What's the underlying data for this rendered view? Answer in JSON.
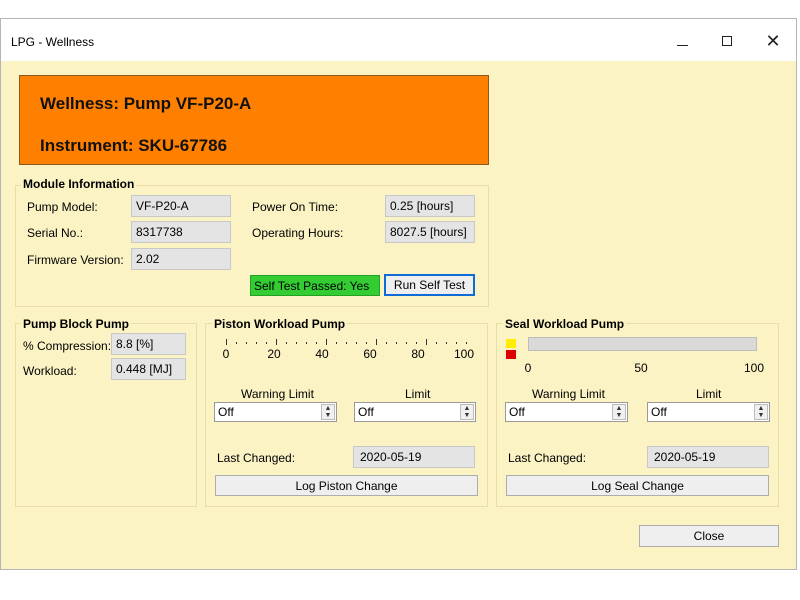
{
  "window": {
    "title": "LPG - Wellness"
  },
  "header": {
    "wellness": "Wellness: Pump VF-P20-A",
    "instrument": "Instrument: SKU-67786",
    "color": "#ff8000"
  },
  "module": {
    "title": "Module Information",
    "pump_model_label": "Pump Model:",
    "pump_model": "VF-P20-A",
    "serial_label": "Serial No.:",
    "serial": "8317738",
    "firmware_label": "Firmware Version:",
    "firmware": "2.02",
    "power_on_label": "Power On Time:",
    "power_on": "0.25 [hours]",
    "operating_label": "Operating Hours:",
    "operating": "8027.5 [hours]",
    "self_test_status": "Self Test Passed: Yes",
    "run_self_test": "Run Self Test"
  },
  "pump_block": {
    "title": "Pump Block Pump",
    "compression_label": "% Compression:",
    "compression": "8.8 [%]",
    "workload_label": "Workload:",
    "workload": "0.448 [MJ]"
  },
  "piston": {
    "title": "Piston Workload Pump",
    "scale": [
      "0",
      "20",
      "40",
      "60",
      "80",
      "100"
    ],
    "warning_limit_label": "Warning Limit",
    "warning_limit": "Off",
    "limit_label": "Limit",
    "limit": "Off",
    "last_changed_label": "Last Changed:",
    "last_changed": "2020-05-19",
    "log_button": "Log Piston Change"
  },
  "seal": {
    "title": "Seal Workload Pump",
    "scale": [
      "0",
      "50",
      "100"
    ],
    "warning_color": "#ffee00",
    "limit_color": "#dd0000",
    "warning_limit_label": "Warning Limit",
    "warning_limit": "Off",
    "limit_label": "Limit",
    "limit": "Off",
    "last_changed_label": "Last Changed:",
    "last_changed": "2020-05-19",
    "log_button": "Log Seal Change"
  },
  "footer": {
    "close": "Close"
  }
}
